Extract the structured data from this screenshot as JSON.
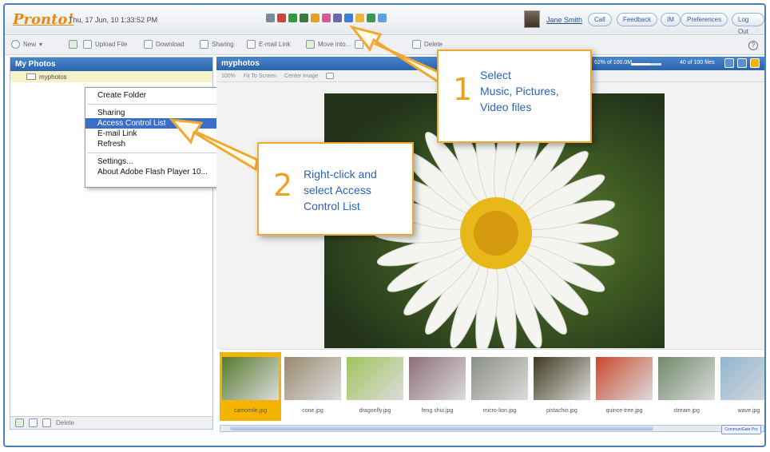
{
  "header": {
    "logo": "Pronto!",
    "datetime": "Thu, 17 Jun, 10 1:33:52 PM",
    "user_name": "Jane Smith",
    "buttons": [
      "Call",
      "Feedback",
      "IM",
      "Preferences",
      "Log Out"
    ],
    "app_icons": [
      {
        "name": "mail-icon",
        "color": "#7c8aa0"
      },
      {
        "name": "calendar-icon",
        "color": "#c9473d"
      },
      {
        "name": "phone-icon",
        "color": "#2f9c3a"
      },
      {
        "name": "contacts-icon",
        "color": "#3a7a3a"
      },
      {
        "name": "notes-icon",
        "color": "#e2a02a"
      },
      {
        "name": "music-icon",
        "color": "#d35a9a"
      },
      {
        "name": "photos-icon",
        "color": "#6a6ab0"
      },
      {
        "name": "video-icon",
        "color": "#3d7fd0"
      },
      {
        "name": "files-icon",
        "color": "#e9b83a"
      },
      {
        "name": "share-icon",
        "color": "#3a9a55"
      },
      {
        "name": "settings-icon",
        "color": "#5ba2e0"
      }
    ]
  },
  "toolbar": {
    "new": "New",
    "upload": "Upload File",
    "download": "Download",
    "sharing": "Sharing",
    "email_link": "E-mail Link",
    "move_into": "Move into...",
    "delete": "Delete",
    "help": "?"
  },
  "left_panel": {
    "title": "My Photos",
    "folder": "myphotos",
    "footer_delete": "Delete"
  },
  "context_menu": {
    "items_top": [
      "Create Folder"
    ],
    "items_mid": [
      "Sharing",
      "Access Control List",
      "E-mail Link",
      "Refresh"
    ],
    "items_bottom": [
      "Settings...",
      "About Adobe Flash Player 10..."
    ],
    "selected": "Access Control List"
  },
  "right_panel": {
    "title": "myphotos",
    "quota_text": "62% of 100.0M",
    "quota_fraction": 0.62,
    "file_count": "40 of 100 files",
    "zoom": "100%",
    "fit": "Fit To Screen",
    "center": "Center Image"
  },
  "thumbnails": [
    {
      "name": "camomile.jpg",
      "active": true,
      "color": "#567a2e"
    },
    {
      "name": "cone.jpg",
      "active": false,
      "color": "#9a8a72"
    },
    {
      "name": "dragonfly.jpg",
      "active": false,
      "color": "#9fc45a"
    },
    {
      "name": "feng shui.jpg",
      "active": false,
      "color": "#8c6e7a"
    },
    {
      "name": "micro-lion.jpg",
      "active": false,
      "color": "#8a8f86"
    },
    {
      "name": "pistachio.jpg",
      "active": false,
      "color": "#3e3a1f"
    },
    {
      "name": "quince tree.jpg",
      "active": false,
      "color": "#c9482d"
    },
    {
      "name": "stream.jpg",
      "active": false,
      "color": "#6f8a6a"
    },
    {
      "name": "wave.jpg",
      "active": false,
      "color": "#8fb6d0"
    }
  ],
  "badge": "CommuniGate Pro",
  "callouts": {
    "one": {
      "number": "1",
      "lines": [
        "Select",
        "Music, Pictures,",
        "Video files"
      ]
    },
    "two": {
      "number": "2",
      "lines": [
        "Right-click and",
        "select Access",
        "Control List"
      ]
    }
  },
  "colors": {
    "accent": "#f0a830",
    "header_blue": "#2a64ab",
    "callout_text": "#2a63b8"
  }
}
